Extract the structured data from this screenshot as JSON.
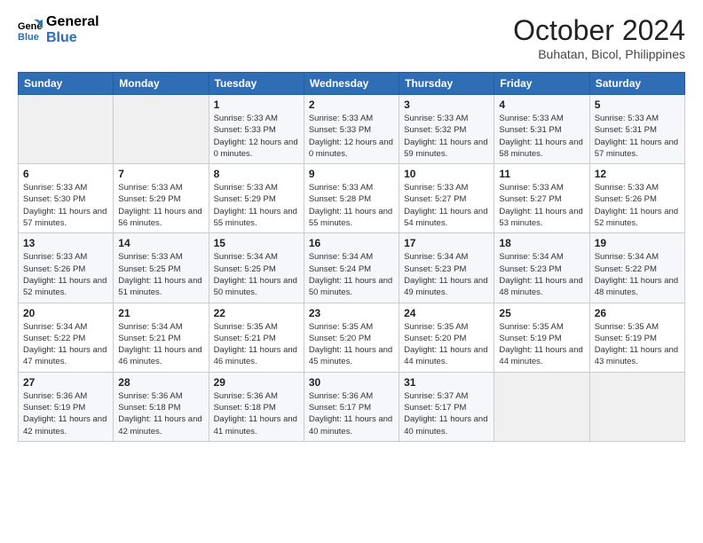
{
  "logo": {
    "line1": "General",
    "line2": "Blue"
  },
  "title": "October 2024",
  "subtitle": "Buhatan, Bicol, Philippines",
  "days_of_week": [
    "Sunday",
    "Monday",
    "Tuesday",
    "Wednesday",
    "Thursday",
    "Friday",
    "Saturday"
  ],
  "weeks": [
    [
      {
        "day": "",
        "info": ""
      },
      {
        "day": "",
        "info": ""
      },
      {
        "day": "1",
        "sunrise": "Sunrise: 5:33 AM",
        "sunset": "Sunset: 5:33 PM",
        "daylight": "Daylight: 12 hours and 0 minutes."
      },
      {
        "day": "2",
        "sunrise": "Sunrise: 5:33 AM",
        "sunset": "Sunset: 5:33 PM",
        "daylight": "Daylight: 12 hours and 0 minutes."
      },
      {
        "day": "3",
        "sunrise": "Sunrise: 5:33 AM",
        "sunset": "Sunset: 5:32 PM",
        "daylight": "Daylight: 11 hours and 59 minutes."
      },
      {
        "day": "4",
        "sunrise": "Sunrise: 5:33 AM",
        "sunset": "Sunset: 5:31 PM",
        "daylight": "Daylight: 11 hours and 58 minutes."
      },
      {
        "day": "5",
        "sunrise": "Sunrise: 5:33 AM",
        "sunset": "Sunset: 5:31 PM",
        "daylight": "Daylight: 11 hours and 57 minutes."
      }
    ],
    [
      {
        "day": "6",
        "sunrise": "Sunrise: 5:33 AM",
        "sunset": "Sunset: 5:30 PM",
        "daylight": "Daylight: 11 hours and 57 minutes."
      },
      {
        "day": "7",
        "sunrise": "Sunrise: 5:33 AM",
        "sunset": "Sunset: 5:29 PM",
        "daylight": "Daylight: 11 hours and 56 minutes."
      },
      {
        "day": "8",
        "sunrise": "Sunrise: 5:33 AM",
        "sunset": "Sunset: 5:29 PM",
        "daylight": "Daylight: 11 hours and 55 minutes."
      },
      {
        "day": "9",
        "sunrise": "Sunrise: 5:33 AM",
        "sunset": "Sunset: 5:28 PM",
        "daylight": "Daylight: 11 hours and 55 minutes."
      },
      {
        "day": "10",
        "sunrise": "Sunrise: 5:33 AM",
        "sunset": "Sunset: 5:27 PM",
        "daylight": "Daylight: 11 hours and 54 minutes."
      },
      {
        "day": "11",
        "sunrise": "Sunrise: 5:33 AM",
        "sunset": "Sunset: 5:27 PM",
        "daylight": "Daylight: 11 hours and 53 minutes."
      },
      {
        "day": "12",
        "sunrise": "Sunrise: 5:33 AM",
        "sunset": "Sunset: 5:26 PM",
        "daylight": "Daylight: 11 hours and 52 minutes."
      }
    ],
    [
      {
        "day": "13",
        "sunrise": "Sunrise: 5:33 AM",
        "sunset": "Sunset: 5:26 PM",
        "daylight": "Daylight: 11 hours and 52 minutes."
      },
      {
        "day": "14",
        "sunrise": "Sunrise: 5:33 AM",
        "sunset": "Sunset: 5:25 PM",
        "daylight": "Daylight: 11 hours and 51 minutes."
      },
      {
        "day": "15",
        "sunrise": "Sunrise: 5:34 AM",
        "sunset": "Sunset: 5:25 PM",
        "daylight": "Daylight: 11 hours and 50 minutes."
      },
      {
        "day": "16",
        "sunrise": "Sunrise: 5:34 AM",
        "sunset": "Sunset: 5:24 PM",
        "daylight": "Daylight: 11 hours and 50 minutes."
      },
      {
        "day": "17",
        "sunrise": "Sunrise: 5:34 AM",
        "sunset": "Sunset: 5:23 PM",
        "daylight": "Daylight: 11 hours and 49 minutes."
      },
      {
        "day": "18",
        "sunrise": "Sunrise: 5:34 AM",
        "sunset": "Sunset: 5:23 PM",
        "daylight": "Daylight: 11 hours and 48 minutes."
      },
      {
        "day": "19",
        "sunrise": "Sunrise: 5:34 AM",
        "sunset": "Sunset: 5:22 PM",
        "daylight": "Daylight: 11 hours and 48 minutes."
      }
    ],
    [
      {
        "day": "20",
        "sunrise": "Sunrise: 5:34 AM",
        "sunset": "Sunset: 5:22 PM",
        "daylight": "Daylight: 11 hours and 47 minutes."
      },
      {
        "day": "21",
        "sunrise": "Sunrise: 5:34 AM",
        "sunset": "Sunset: 5:21 PM",
        "daylight": "Daylight: 11 hours and 46 minutes."
      },
      {
        "day": "22",
        "sunrise": "Sunrise: 5:35 AM",
        "sunset": "Sunset: 5:21 PM",
        "daylight": "Daylight: 11 hours and 46 minutes."
      },
      {
        "day": "23",
        "sunrise": "Sunrise: 5:35 AM",
        "sunset": "Sunset: 5:20 PM",
        "daylight": "Daylight: 11 hours and 45 minutes."
      },
      {
        "day": "24",
        "sunrise": "Sunrise: 5:35 AM",
        "sunset": "Sunset: 5:20 PM",
        "daylight": "Daylight: 11 hours and 44 minutes."
      },
      {
        "day": "25",
        "sunrise": "Sunrise: 5:35 AM",
        "sunset": "Sunset: 5:19 PM",
        "daylight": "Daylight: 11 hours and 44 minutes."
      },
      {
        "day": "26",
        "sunrise": "Sunrise: 5:35 AM",
        "sunset": "Sunset: 5:19 PM",
        "daylight": "Daylight: 11 hours and 43 minutes."
      }
    ],
    [
      {
        "day": "27",
        "sunrise": "Sunrise: 5:36 AM",
        "sunset": "Sunset: 5:19 PM",
        "daylight": "Daylight: 11 hours and 42 minutes."
      },
      {
        "day": "28",
        "sunrise": "Sunrise: 5:36 AM",
        "sunset": "Sunset: 5:18 PM",
        "daylight": "Daylight: 11 hours and 42 minutes."
      },
      {
        "day": "29",
        "sunrise": "Sunrise: 5:36 AM",
        "sunset": "Sunset: 5:18 PM",
        "daylight": "Daylight: 11 hours and 41 minutes."
      },
      {
        "day": "30",
        "sunrise": "Sunrise: 5:36 AM",
        "sunset": "Sunset: 5:17 PM",
        "daylight": "Daylight: 11 hours and 40 minutes."
      },
      {
        "day": "31",
        "sunrise": "Sunrise: 5:37 AM",
        "sunset": "Sunset: 5:17 PM",
        "daylight": "Daylight: 11 hours and 40 minutes."
      },
      {
        "day": "",
        "info": ""
      },
      {
        "day": "",
        "info": ""
      }
    ]
  ]
}
